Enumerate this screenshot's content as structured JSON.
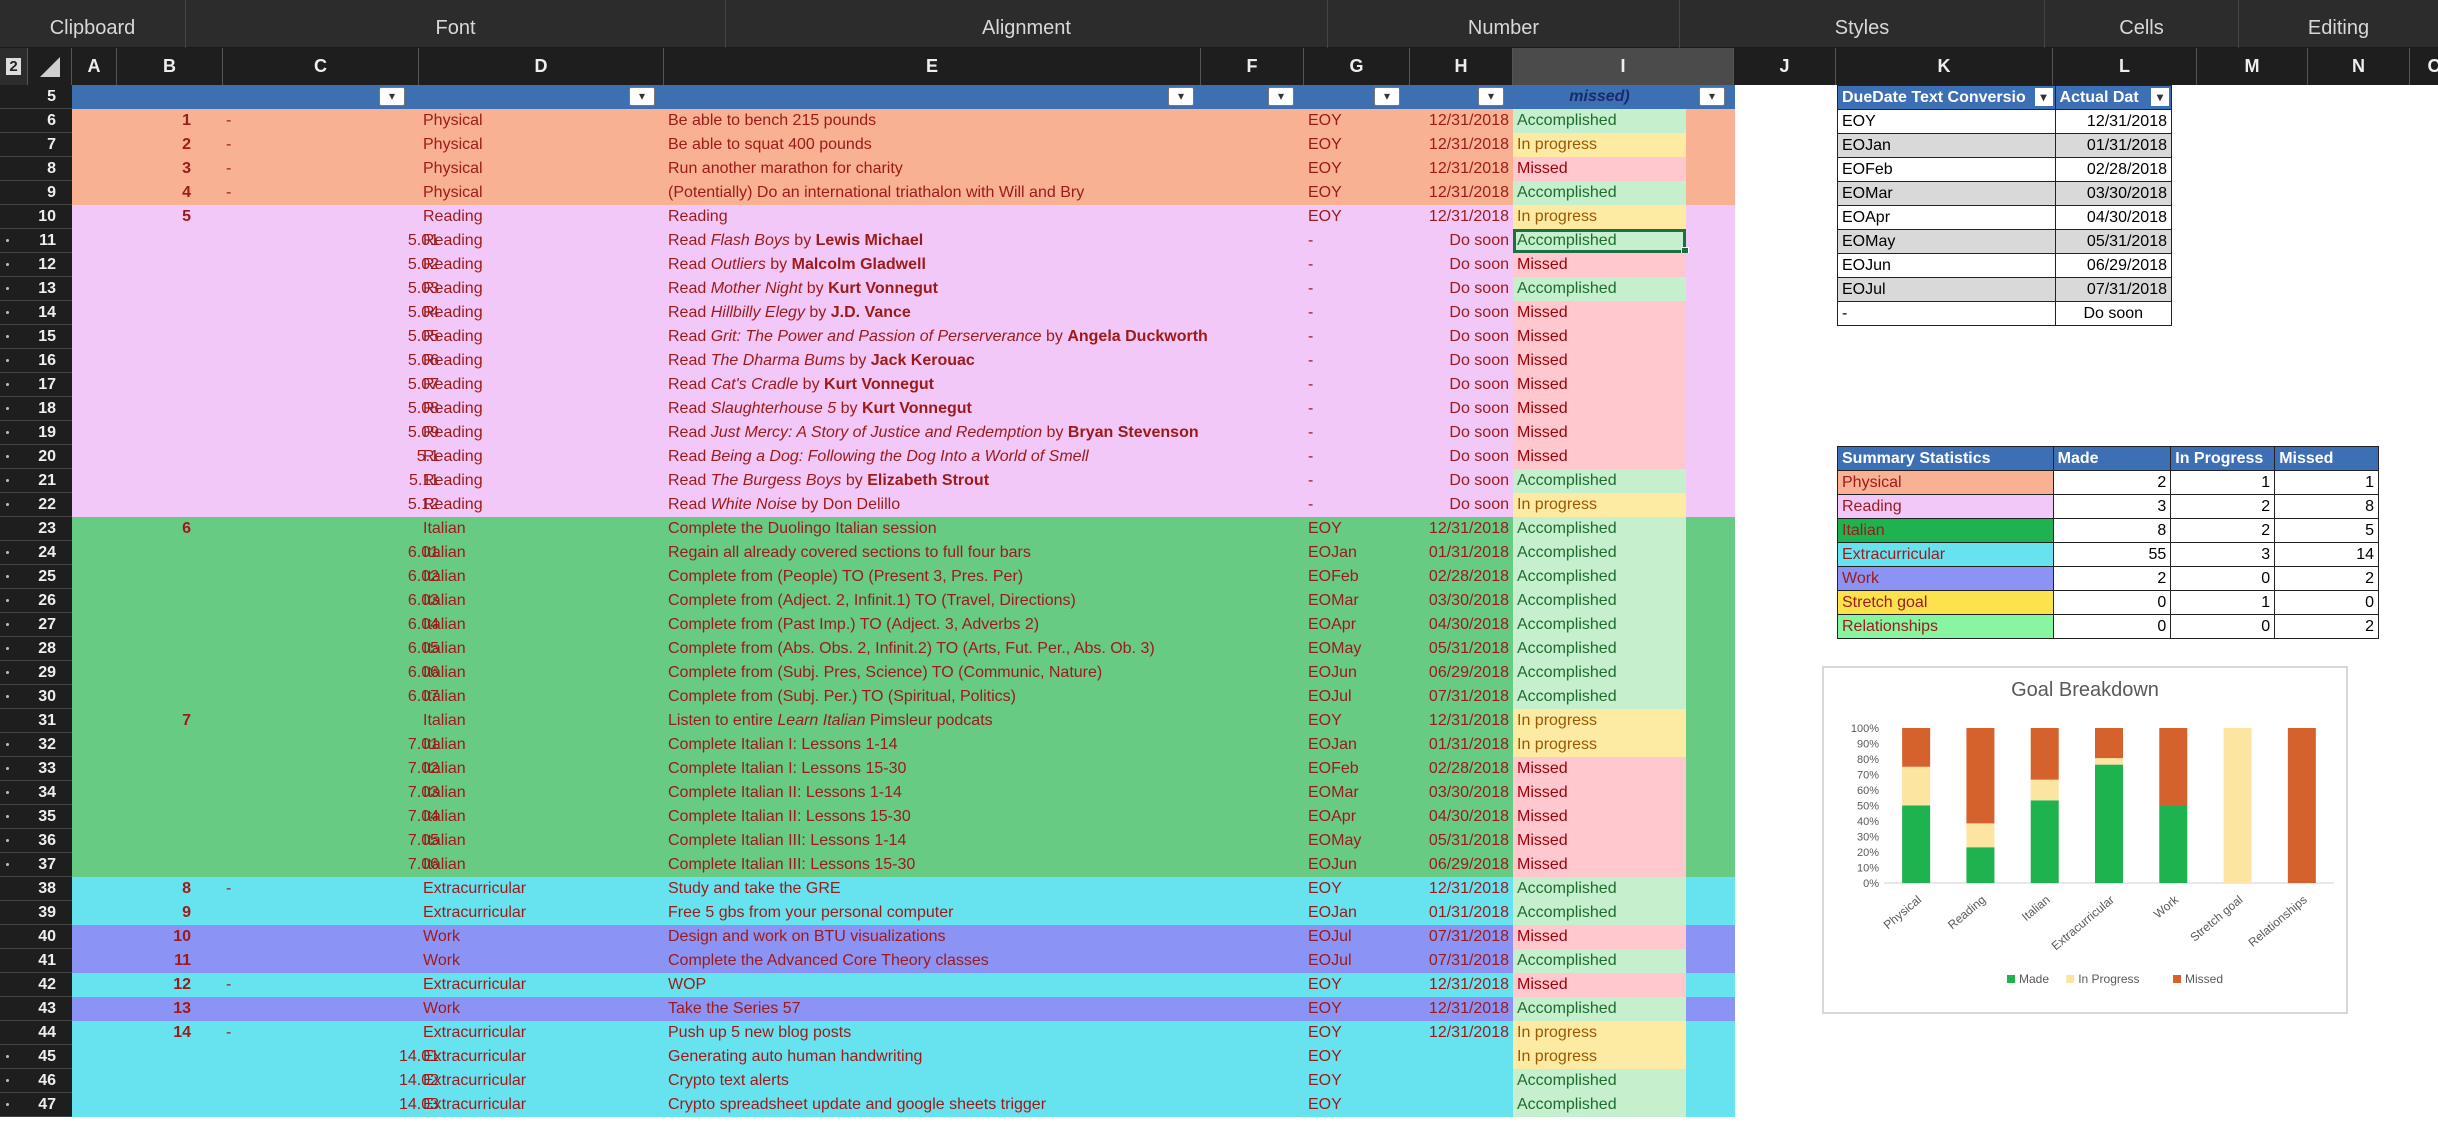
{
  "ribbon": {
    "groups": [
      "Clipboard",
      "Font",
      "Alignment",
      "Number",
      "Styles",
      "Cells",
      "Editing"
    ]
  },
  "name_box": "2",
  "columns": [
    "A",
    "B",
    "C",
    "D",
    "E",
    "F",
    "G",
    "H",
    "I",
    "J",
    "K",
    "L",
    "M",
    "N",
    "O"
  ],
  "header_row": {
    "num": "5",
    "i_text": "missed)"
  },
  "rows": [
    {
      "n": "6",
      "dot": false,
      "b": "1",
      "dash": "-",
      "c": "",
      "d": "Physical",
      "e": [
        {
          "t": "Be able to bench 215 pounds"
        }
      ],
      "g": "EOY",
      "h": "12/31/2018",
      "i": "Accomplished",
      "cat": "physical"
    },
    {
      "n": "7",
      "dot": false,
      "b": "2",
      "dash": "-",
      "c": "",
      "d": "Physical",
      "e": [
        {
          "t": "Be able to squat 400 pounds"
        }
      ],
      "g": "EOY",
      "h": "12/31/2018",
      "i": "In progress",
      "cat": "physical"
    },
    {
      "n": "8",
      "dot": false,
      "b": "3",
      "dash": "-",
      "c": "",
      "d": "Physical",
      "e": [
        {
          "t": "Run another marathon for charity"
        }
      ],
      "g": "EOY",
      "h": "12/31/2018",
      "i": "Missed",
      "cat": "physical"
    },
    {
      "n": "9",
      "dot": false,
      "b": "4",
      "dash": "-",
      "c": "",
      "d": "Physical",
      "e": [
        {
          "t": "(Potentially) Do an international triathalon with Will and Bry"
        }
      ],
      "g": "EOY",
      "h": "12/31/2018",
      "i": "Accomplished",
      "cat": "physical"
    },
    {
      "n": "10",
      "dot": false,
      "b": "5",
      "dash": "",
      "c": "",
      "d": "Reading",
      "e": [
        {
          "t": "Reading"
        }
      ],
      "g": "EOY",
      "h": "12/31/2018",
      "i": "In progress",
      "cat": "reading"
    },
    {
      "n": "11",
      "dot": true,
      "b": "",
      "dash": "",
      "c": "5.01",
      "d": "Reading",
      "e": [
        {
          "t": "Read "
        },
        {
          "t": "Flash Boys",
          "s": "i"
        },
        {
          "t": "  by "
        },
        {
          "t": "Lewis Michael",
          "s": "b"
        }
      ],
      "g": "-",
      "h": "Do soon",
      "i": "Accomplished",
      "cat": "reading",
      "active": true
    },
    {
      "n": "12",
      "dot": true,
      "b": "",
      "dash": "",
      "c": "5.02",
      "d": "Reading",
      "e": [
        {
          "t": "Read "
        },
        {
          "t": "Outliers",
          "s": "i"
        },
        {
          "t": "  by "
        },
        {
          "t": "Malcolm Gladwell",
          "s": "b"
        }
      ],
      "g": "-",
      "h": "Do soon",
      "i": "Missed",
      "cat": "reading"
    },
    {
      "n": "13",
      "dot": true,
      "b": "",
      "dash": "",
      "c": "5.03",
      "d": "Reading",
      "e": [
        {
          "t": "Read "
        },
        {
          "t": "Mother Night",
          "s": "i"
        },
        {
          "t": "  by "
        },
        {
          "t": "Kurt Vonnegut",
          "s": "b"
        }
      ],
      "g": "-",
      "h": "Do soon",
      "i": "Accomplished",
      "cat": "reading"
    },
    {
      "n": "14",
      "dot": true,
      "b": "",
      "dash": "",
      "c": "5.04",
      "d": "Reading",
      "e": [
        {
          "t": "Read "
        },
        {
          "t": "Hillbilly Elegy",
          "s": "i"
        },
        {
          "t": "  by "
        },
        {
          "t": "J.D. Vance",
          "s": "b"
        }
      ],
      "g": "-",
      "h": "Do soon",
      "i": "Missed",
      "cat": "reading"
    },
    {
      "n": "15",
      "dot": true,
      "b": "",
      "dash": "",
      "c": "5.05",
      "d": "Reading",
      "e": [
        {
          "t": "Read "
        },
        {
          "t": "Grit: The Power and Passion of Perserverance",
          "s": "i"
        },
        {
          "t": "  by "
        },
        {
          "t": "Angela Duckworth",
          "s": "b"
        }
      ],
      "g": "-",
      "h": "Do soon",
      "i": "Missed",
      "cat": "reading"
    },
    {
      "n": "16",
      "dot": true,
      "b": "",
      "dash": "",
      "c": "5.06",
      "d": "Reading",
      "e": [
        {
          "t": "Read "
        },
        {
          "t": "The Dharma Bums",
          "s": "i"
        },
        {
          "t": "  by "
        },
        {
          "t": "Jack Kerouac",
          "s": "b"
        }
      ],
      "g": "-",
      "h": "Do soon",
      "i": "Missed",
      "cat": "reading"
    },
    {
      "n": "17",
      "dot": true,
      "b": "",
      "dash": "",
      "c": "5.07",
      "d": "Reading",
      "e": [
        {
          "t": "Read "
        },
        {
          "t": "Cat's Cradle",
          "s": "i"
        },
        {
          "t": "  by "
        },
        {
          "t": "Kurt Vonnegut",
          "s": "b"
        }
      ],
      "g": "-",
      "h": "Do soon",
      "i": "Missed",
      "cat": "reading"
    },
    {
      "n": "18",
      "dot": true,
      "b": "",
      "dash": "",
      "c": "5.08",
      "d": "Reading",
      "e": [
        {
          "t": "Read "
        },
        {
          "t": "Slaughterhouse 5",
          "s": "i"
        },
        {
          "t": "  by "
        },
        {
          "t": "Kurt Vonnegut",
          "s": "b"
        }
      ],
      "g": "-",
      "h": "Do soon",
      "i": "Missed",
      "cat": "reading"
    },
    {
      "n": "19",
      "dot": true,
      "b": "",
      "dash": "",
      "c": "5.09",
      "d": "Reading",
      "e": [
        {
          "t": "Read "
        },
        {
          "t": "Just Mercy: A Story of Justice and Redemption",
          "s": "i"
        },
        {
          "t": "  by "
        },
        {
          "t": "Bryan Stevenson",
          "s": "b"
        }
      ],
      "g": "-",
      "h": "Do soon",
      "i": "Missed",
      "cat": "reading"
    },
    {
      "n": "20",
      "dot": true,
      "b": "",
      "dash": "",
      "c": "5.1",
      "d": "Reading",
      "e": [
        {
          "t": "Read "
        },
        {
          "t": "Being a Dog: Following the Dog Into a World of Smell",
          "s": "i"
        }
      ],
      "g": "-",
      "h": "Do soon",
      "i": "Missed",
      "cat": "reading"
    },
    {
      "n": "21",
      "dot": true,
      "b": "",
      "dash": "",
      "c": "5.11",
      "d": "Reading",
      "e": [
        {
          "t": "Read "
        },
        {
          "t": "The Burgess Boys",
          "s": "i"
        },
        {
          "t": "  by "
        },
        {
          "t": "Elizabeth Strout",
          "s": "b"
        }
      ],
      "g": "-",
      "h": "Do soon",
      "i": "Accomplished",
      "cat": "reading"
    },
    {
      "n": "22",
      "dot": true,
      "b": "",
      "dash": "",
      "c": "5.12",
      "d": "Reading",
      "e": [
        {
          "t": "Read "
        },
        {
          "t": "White Noise",
          "s": "i"
        },
        {
          "t": "  by Don Delillo"
        }
      ],
      "g": "-",
      "h": "Do soon",
      "i": "In progress",
      "cat": "reading"
    },
    {
      "n": "23",
      "dot": false,
      "b": "6",
      "dash": "",
      "c": "",
      "d": "Italian",
      "e": [
        {
          "t": "Complete the Duolingo Italian session"
        }
      ],
      "g": "EOY",
      "h": "12/31/2018",
      "i": "Accomplished",
      "cat": "italian"
    },
    {
      "n": "24",
      "dot": true,
      "b": "",
      "dash": "",
      "c": "6.01",
      "d": "Italian",
      "e": [
        {
          "t": "Regain all already covered sections to full four bars"
        }
      ],
      "g": "EOJan",
      "h": "01/31/2018",
      "i": "Accomplished",
      "cat": "italian"
    },
    {
      "n": "25",
      "dot": true,
      "b": "",
      "dash": "",
      "c": "6.02",
      "d": "Italian",
      "e": [
        {
          "t": "Complete from (People) TO (Present 3, Pres. Per)"
        }
      ],
      "g": "EOFeb",
      "h": "02/28/2018",
      "i": "Accomplished",
      "cat": "italian"
    },
    {
      "n": "26",
      "dot": true,
      "b": "",
      "dash": "",
      "c": "6.03",
      "d": "Italian",
      "e": [
        {
          "t": "Complete from (Adject. 2, Infinit.1) TO (Travel, Directions)"
        }
      ],
      "g": "EOMar",
      "h": "03/30/2018",
      "i": "Accomplished",
      "cat": "italian"
    },
    {
      "n": "27",
      "dot": true,
      "b": "",
      "dash": "",
      "c": "6.04",
      "d": "Italian",
      "e": [
        {
          "t": "Complete from (Past Imp.) TO (Adject. 3, Adverbs 2)"
        }
      ],
      "g": "EOApr",
      "h": "04/30/2018",
      "i": "Accomplished",
      "cat": "italian"
    },
    {
      "n": "28",
      "dot": true,
      "b": "",
      "dash": "",
      "c": "6.05",
      "d": "Italian",
      "e": [
        {
          "t": "Complete from (Abs. Obs. 2, Infinit.2) TO (Arts, Fut. Per., Abs. Ob. 3)"
        }
      ],
      "g": "EOMay",
      "h": "05/31/2018",
      "i": "Accomplished",
      "cat": "italian"
    },
    {
      "n": "29",
      "dot": true,
      "b": "",
      "dash": "",
      "c": "6.06",
      "d": "Italian",
      "e": [
        {
          "t": "Complete from (Subj. Pres, Science) TO (Communic, Nature)"
        }
      ],
      "g": "EOJun",
      "h": "06/29/2018",
      "i": "Accomplished",
      "cat": "italian"
    },
    {
      "n": "30",
      "dot": true,
      "b": "",
      "dash": "",
      "c": "6.07",
      "d": "Italian",
      "e": [
        {
          "t": "Complete from (Subj. Per.) TO (Spiritual, Politics)"
        }
      ],
      "g": "EOJul",
      "h": "07/31/2018",
      "i": "Accomplished",
      "cat": "italian"
    },
    {
      "n": "31",
      "dot": false,
      "b": "7",
      "dash": "",
      "c": "",
      "d": "Italian",
      "e": [
        {
          "t": "Listen to entire "
        },
        {
          "t": "Learn Italian",
          "s": "i"
        },
        {
          "t": "  Pimsleur podcats"
        }
      ],
      "g": "EOY",
      "h": "12/31/2018",
      "i": "In progress",
      "cat": "italian"
    },
    {
      "n": "32",
      "dot": true,
      "b": "",
      "dash": "",
      "c": "7.01",
      "d": "Italian",
      "e": [
        {
          "t": "Complete Italian I: Lessons 1-14"
        }
      ],
      "g": "EOJan",
      "h": "01/31/2018",
      "i": "In progress",
      "cat": "italian"
    },
    {
      "n": "33",
      "dot": true,
      "b": "",
      "dash": "",
      "c": "7.02",
      "d": "Italian",
      "e": [
        {
          "t": "Complete Italian I: Lessons 15-30"
        }
      ],
      "g": "EOFeb",
      "h": "02/28/2018",
      "i": "Missed",
      "cat": "italian"
    },
    {
      "n": "34",
      "dot": true,
      "b": "",
      "dash": "",
      "c": "7.03",
      "d": "Italian",
      "e": [
        {
          "t": "Complete Italian II: Lessons 1-14"
        }
      ],
      "g": "EOMar",
      "h": "03/30/2018",
      "i": "Missed",
      "cat": "italian"
    },
    {
      "n": "35",
      "dot": true,
      "b": "",
      "dash": "",
      "c": "7.04",
      "d": "Italian",
      "e": [
        {
          "t": "Complete Italian II: Lessons 15-30"
        }
      ],
      "g": "EOApr",
      "h": "04/30/2018",
      "i": "Missed",
      "cat": "italian"
    },
    {
      "n": "36",
      "dot": true,
      "b": "",
      "dash": "",
      "c": "7.05",
      "d": "Italian",
      "e": [
        {
          "t": "Complete Italian III: Lessons 1-14"
        }
      ],
      "g": "EOMay",
      "h": "05/31/2018",
      "i": "Missed",
      "cat": "italian"
    },
    {
      "n": "37",
      "dot": true,
      "b": "",
      "dash": "",
      "c": "7.06",
      "d": "Italian",
      "e": [
        {
          "t": "Complete Italian III: Lessons 15-30"
        }
      ],
      "g": "EOJun",
      "h": "06/29/2018",
      "i": "Missed",
      "cat": "italian"
    },
    {
      "n": "38",
      "dot": false,
      "b": "8",
      "dash": "-",
      "c": "",
      "d": "Extracurricular",
      "e": [
        {
          "t": "Study and take the GRE"
        }
      ],
      "g": "EOY",
      "h": "12/31/2018",
      "i": "Accomplished",
      "cat": "extra"
    },
    {
      "n": "39",
      "dot": false,
      "b": "9",
      "dash": "",
      "c": "",
      "d": "Extracurricular",
      "e": [
        {
          "t": "Free 5 gbs from your personal computer"
        }
      ],
      "g": "EOJan",
      "h": "01/31/2018",
      "i": "Accomplished",
      "cat": "extra"
    },
    {
      "n": "40",
      "dot": false,
      "b": "10",
      "dash": "",
      "c": "",
      "d": "Work",
      "e": [
        {
          "t": "Design and work on BTU visualizations"
        }
      ],
      "g": "EOJul",
      "h": "07/31/2018",
      "i": "Missed",
      "cat": "work"
    },
    {
      "n": "41",
      "dot": false,
      "b": "11",
      "dash": "",
      "c": "",
      "d": "Work",
      "e": [
        {
          "t": "Complete the Advanced Core Theory classes"
        }
      ],
      "g": "EOJul",
      "h": "07/31/2018",
      "i": "Accomplished",
      "cat": "work"
    },
    {
      "n": "42",
      "dot": false,
      "b": "12",
      "dash": "-",
      "c": "",
      "d": "Extracurricular",
      "e": [
        {
          "t": "WOP"
        }
      ],
      "g": "EOY",
      "h": "12/31/2018",
      "i": "Missed",
      "cat": "extra"
    },
    {
      "n": "43",
      "dot": false,
      "b": "13",
      "dash": "",
      "c": "",
      "d": "Work",
      "e": [
        {
          "t": "Take the Series 57"
        }
      ],
      "g": "EOY",
      "h": "12/31/2018",
      "i": "Accomplished",
      "cat": "work"
    },
    {
      "n": "44",
      "dot": false,
      "b": "14",
      "dash": "-",
      "c": "",
      "d": "Extracurricular",
      "e": [
        {
          "t": "Push up 5 new blog posts"
        }
      ],
      "g": "EOY",
      "h": "12/31/2018",
      "i": "In progress",
      "cat": "extra"
    },
    {
      "n": "45",
      "dot": true,
      "b": "",
      "dash": "",
      "c": "14.01",
      "d": "Extracurricular",
      "e": [
        {
          "t": "Generating auto human handwriting"
        }
      ],
      "g": "EOY",
      "h": "",
      "i": "In progress",
      "cat": "extra"
    },
    {
      "n": "46",
      "dot": true,
      "b": "",
      "dash": "",
      "c": "14.02",
      "d": "Extracurricular",
      "e": [
        {
          "t": "Crypto text alerts"
        }
      ],
      "g": "EOY",
      "h": "",
      "i": "Accomplished",
      "cat": "extra"
    },
    {
      "n": "47",
      "dot": true,
      "b": "",
      "dash": "",
      "c": "14.03",
      "d": "Extracurricular",
      "e": [
        {
          "t": "Crypto spreadsheet update and google sheets trigger"
        }
      ],
      "g": "EOY",
      "h": "",
      "i": "Accomplished",
      "cat": "extra"
    }
  ],
  "colors": {
    "physical": "#f9b193",
    "reading": "#f1c8f7",
    "italian": "#67cb83",
    "extra": "#67e3f0",
    "work": "#8b94f5",
    "stretch": "#fce24c",
    "relationships": "#88f5a0",
    "accomplished": "#c6efce",
    "in_progress": "#fdeba3",
    "missed": "#ffc7ce",
    "text_red": "#9c1a1a",
    "header_blue": "#3d6fb5"
  },
  "duedate": {
    "headers": [
      "DueDate Text Conversio",
      "Actual Dat"
    ],
    "rows": [
      [
        "EOY",
        "12/31/2018"
      ],
      [
        "EOJan",
        "01/31/2018"
      ],
      [
        "EOFeb",
        "02/28/2018"
      ],
      [
        "EOMar",
        "03/30/2018"
      ],
      [
        "EOApr",
        "04/30/2018"
      ],
      [
        "EOMay",
        "05/31/2018"
      ],
      [
        "EOJun",
        "06/29/2018"
      ],
      [
        "EOJul",
        "07/31/2018"
      ],
      [
        "-",
        "Do soon"
      ]
    ]
  },
  "summary": {
    "headers": [
      "Summary Statistics",
      "Made",
      "In Progress",
      "Missed"
    ],
    "rows": [
      {
        "label": "Physical",
        "made": "2",
        "prog": "1",
        "missed": "1",
        "color": "#f9b193"
      },
      {
        "label": "Reading",
        "made": "3",
        "prog": "2",
        "missed": "8",
        "color": "#f1c8f7"
      },
      {
        "label": "Italian",
        "made": "8",
        "prog": "2",
        "missed": "5",
        "color": "#1eb34f"
      },
      {
        "label": "Extracurricular",
        "made": "55",
        "prog": "3",
        "missed": "14",
        "color": "#67e3f0"
      },
      {
        "label": "Work",
        "made": "2",
        "prog": "0",
        "missed": "2",
        "color": "#8b94f5"
      },
      {
        "label": "Stretch goal",
        "made": "0",
        "prog": "1",
        "missed": "0",
        "color": "#fce24c"
      },
      {
        "label": "Relationships",
        "made": "0",
        "prog": "0",
        "missed": "2",
        "color": "#88f5a0"
      }
    ]
  },
  "chart_data": {
    "type": "bar",
    "stacked": "percent",
    "title": "Goal Breakdown",
    "categories": [
      "Physical",
      "Reading",
      "Italian",
      "Extracurricular",
      "Work",
      "Stretch goal",
      "Relationships"
    ],
    "series": [
      {
        "name": "Made",
        "values": [
          2,
          3,
          8,
          55,
          2,
          0,
          0
        ],
        "color": "#1eb34f"
      },
      {
        "name": "In Progress",
        "values": [
          1,
          2,
          2,
          3,
          0,
          1,
          0
        ],
        "color": "#fce4a1"
      },
      {
        "name": "Missed",
        "values": [
          1,
          8,
          5,
          14,
          2,
          0,
          2
        ],
        "color": "#d5612c"
      }
    ],
    "yticks": [
      "0%",
      "10%",
      "20%",
      "30%",
      "40%",
      "50%",
      "60%",
      "70%",
      "80%",
      "90%",
      "100%"
    ],
    "ylim": [
      0,
      100
    ],
    "legend": "bottom",
    "grid": false
  }
}
